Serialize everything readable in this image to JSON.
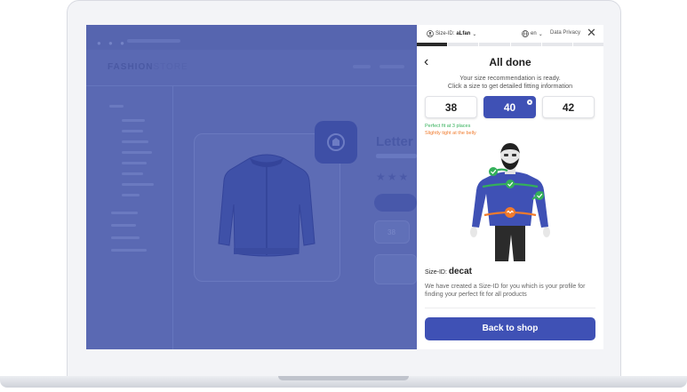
{
  "shop": {
    "logo_bold": "FASHION",
    "logo_light": "STORE",
    "product_title": "Letter",
    "stars": "★★★",
    "size_chip": "38"
  },
  "panel": {
    "header": {
      "sizeid_prefix": "Size-ID:",
      "sizeid_user": "aLfan",
      "language": "en",
      "privacy": "Data Privacy"
    },
    "progress_steps": [
      true,
      false,
      false,
      false,
      false,
      false
    ],
    "title": "All done",
    "desc_line1": "Your size recommendation is ready.",
    "desc_line2": "Click a size to get detailed fitting information",
    "sizes": [
      {
        "label": "38",
        "selected": false
      },
      {
        "label": "40",
        "selected": true
      },
      {
        "label": "42",
        "selected": false
      }
    ],
    "fit_good": "Perfect fit at 3 places",
    "fit_warn": "Slightly tight at the belly",
    "sizeid_section": {
      "prefix": "Size-ID:",
      "name": "decat",
      "text": "We have created a Size-ID for you which is your profile for finding your perfect fit for all products"
    },
    "cta": "Back to shop"
  },
  "colors": {
    "accent": "#3f51b5",
    "good": "#34b05a",
    "warn": "#f07a2c",
    "overlay": "#5a69b3"
  }
}
